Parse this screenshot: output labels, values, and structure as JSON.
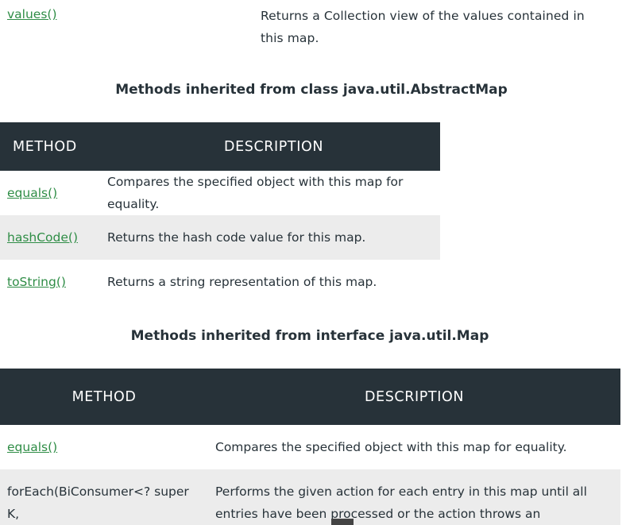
{
  "top_row": {
    "method": "values()",
    "description": "Returns a Collection view of the values contained in this map."
  },
  "section1": {
    "heading": "Methods inherited from class java.util.AbstractMap",
    "columns": {
      "method": "METHOD",
      "description": "DESCRIPTION"
    },
    "rows": [
      {
        "method": "equals()",
        "description": "Compares the specified object with this map for equality."
      },
      {
        "method": "hashCode()",
        "description": "Returns the hash code value for this map."
      },
      {
        "method": "toString()",
        "description": "Returns a string representation of this map."
      }
    ]
  },
  "section2": {
    "heading": "Methods inherited from interface java.util.Map",
    "columns": {
      "method": "METHOD",
      "description": "DESCRIPTION"
    },
    "rows": [
      {
        "method": "equals()",
        "description": "Compares the specified object with this map for equality."
      },
      {
        "method": "forEach(BiConsumer<? super K,",
        "description": "Performs the given action for each entry in this map until all entries have been processed or the action throws an exception."
      }
    ]
  }
}
